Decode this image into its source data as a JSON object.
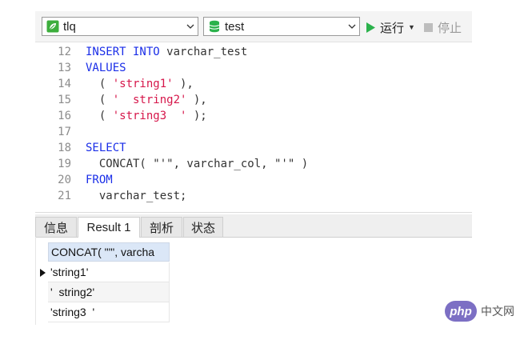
{
  "toolbar": {
    "connection": "tlq",
    "database": "test",
    "run_label": "运行",
    "stop_label": "停止"
  },
  "editor": {
    "lines": [
      {
        "num": "12",
        "parts": [
          {
            "t": "INSERT INTO",
            "k": "kw"
          },
          {
            "t": " varchar_test",
            "k": "code"
          }
        ]
      },
      {
        "num": "13",
        "parts": [
          {
            "t": "VALUES",
            "k": "kw"
          }
        ]
      },
      {
        "num": "14",
        "parts": [
          {
            "t": "  ( ",
            "k": "code"
          },
          {
            "t": "'string1'",
            "k": "str"
          },
          {
            "t": " ),",
            "k": "code"
          }
        ]
      },
      {
        "num": "15",
        "parts": [
          {
            "t": "  ( ",
            "k": "code"
          },
          {
            "t": "'  string2'",
            "k": "str"
          },
          {
            "t": " ),",
            "k": "code"
          }
        ]
      },
      {
        "num": "16",
        "parts": [
          {
            "t": "  ( ",
            "k": "code"
          },
          {
            "t": "'string3  '",
            "k": "str"
          },
          {
            "t": " );",
            "k": "code"
          }
        ]
      },
      {
        "num": "17",
        "parts": []
      },
      {
        "num": "18",
        "parts": [
          {
            "t": "SELECT",
            "k": "kw"
          }
        ]
      },
      {
        "num": "19",
        "parts": [
          {
            "t": "  CONCAT( \"'\", varchar_col, \"'\" )",
            "k": "code"
          }
        ]
      },
      {
        "num": "20",
        "parts": [
          {
            "t": "FROM",
            "k": "kw"
          }
        ]
      },
      {
        "num": "21",
        "parts": [
          {
            "t": "  varchar_test;",
            "k": "code"
          }
        ]
      }
    ]
  },
  "tabs": [
    {
      "label": "信息",
      "active": false
    },
    {
      "label": "Result 1",
      "active": true
    },
    {
      "label": "剖析",
      "active": false
    },
    {
      "label": "状态",
      "active": false
    }
  ],
  "results": {
    "column": "CONCAT( \"'\", varcha",
    "rows": [
      "'string1'",
      "'  string2'",
      "'string3  '"
    ],
    "current_row": 0
  },
  "watermark": {
    "logo": "php",
    "text": "中文网"
  },
  "colors": {
    "keyword": "#1a2ee8",
    "string": "#d6164a",
    "run_green": "#2bb24c"
  }
}
